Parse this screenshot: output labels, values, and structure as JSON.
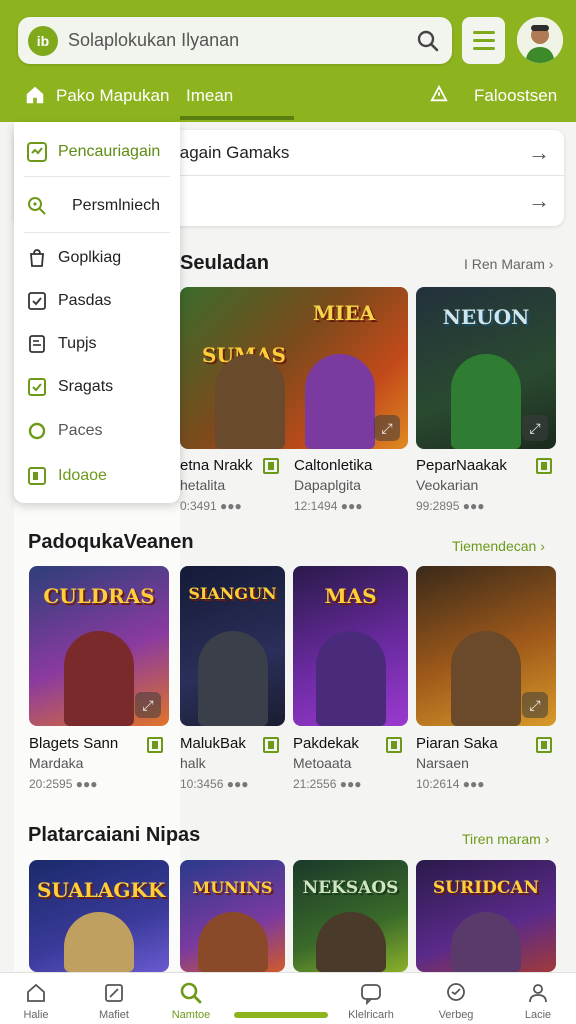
{
  "header": {
    "search_placeholder": "Solaplokukan Ilyanan",
    "logo_text": "ib",
    "nav_home_label": "Pako Mapukan",
    "nav_tab_label": "Imean",
    "nav_right_label": "Faloostsen"
  },
  "suggestions": {
    "row1": "lagain Gamaks",
    "row2": ""
  },
  "dropdown": {
    "items": [
      {
        "label": "Pencauriagain",
        "icon": "check-square-icon"
      },
      {
        "label": "Persmlniech",
        "icon": "search-icon"
      },
      {
        "label": "Goplkiag",
        "icon": "bag-icon"
      },
      {
        "label": "Pasdas",
        "icon": "checkbox-icon"
      },
      {
        "label": "Tupjs",
        "icon": "document-icon"
      },
      {
        "label": "Sragats",
        "icon": "checkbox-icon"
      },
      {
        "label": "Paces",
        "icon": "circle-icon"
      },
      {
        "label": "Idoaoe",
        "icon": "book-icon"
      }
    ]
  },
  "section1": {
    "title": "Seuladan",
    "link": "I Ren Maram ›",
    "games": [
      {
        "art": "SUMAS",
        "title": "etna Nrakk",
        "sub": "hetalita",
        "meta": "0:3491 ●●●"
      },
      {
        "art": "MIEA",
        "title": "Caltonletika",
        "sub": "Dapaplgita",
        "meta": "12:1494 ●●●"
      },
      {
        "art": "NEUON",
        "title": "PeparNaakak",
        "sub": "Veokarian",
        "meta": "99:2895 ●●●"
      }
    ]
  },
  "section2": {
    "title": "PadoqukaVeanen",
    "link": "Tiemendecan ›",
    "games": [
      {
        "art": "CULDRAS",
        "title": "Blagets Sann",
        "sub": "Mardaka",
        "meta": "20:2595 ●●●"
      },
      {
        "art": "SIANGUN",
        "title": "MalukBak",
        "sub": "halk",
        "meta": "10:3456 ●●●"
      },
      {
        "art": "MAS",
        "title": "Pakdekak",
        "sub": "Metoaata",
        "meta": "21:2556 ●●●"
      },
      {
        "art": "",
        "title": "Piaran Saka",
        "sub": "Narsaen",
        "meta": "10:2614 ●●●"
      }
    ]
  },
  "section3": {
    "title": "Platarcaiani Nipas",
    "link": "Tiren maram ›",
    "games": [
      {
        "art": "SUALAGKK"
      },
      {
        "art": "MUNINS"
      },
      {
        "art": "NEKSAOS"
      },
      {
        "art": "SURIDCAN"
      }
    ]
  },
  "bottom_nav": {
    "items": [
      {
        "label": "Halie",
        "icon": "home-icon"
      },
      {
        "label": "Mafiet",
        "icon": "edit-icon"
      },
      {
        "label": "Namtoe",
        "icon": "search-icon"
      },
      {
        "label": "Klelricarh",
        "icon": "chat-icon"
      },
      {
        "label": "Verbeg",
        "icon": "message-icon"
      },
      {
        "label": "Lacie",
        "icon": "profile-icon"
      }
    ]
  },
  "colors": {
    "brand": "#8db41e",
    "accent": "#6c9a18"
  }
}
